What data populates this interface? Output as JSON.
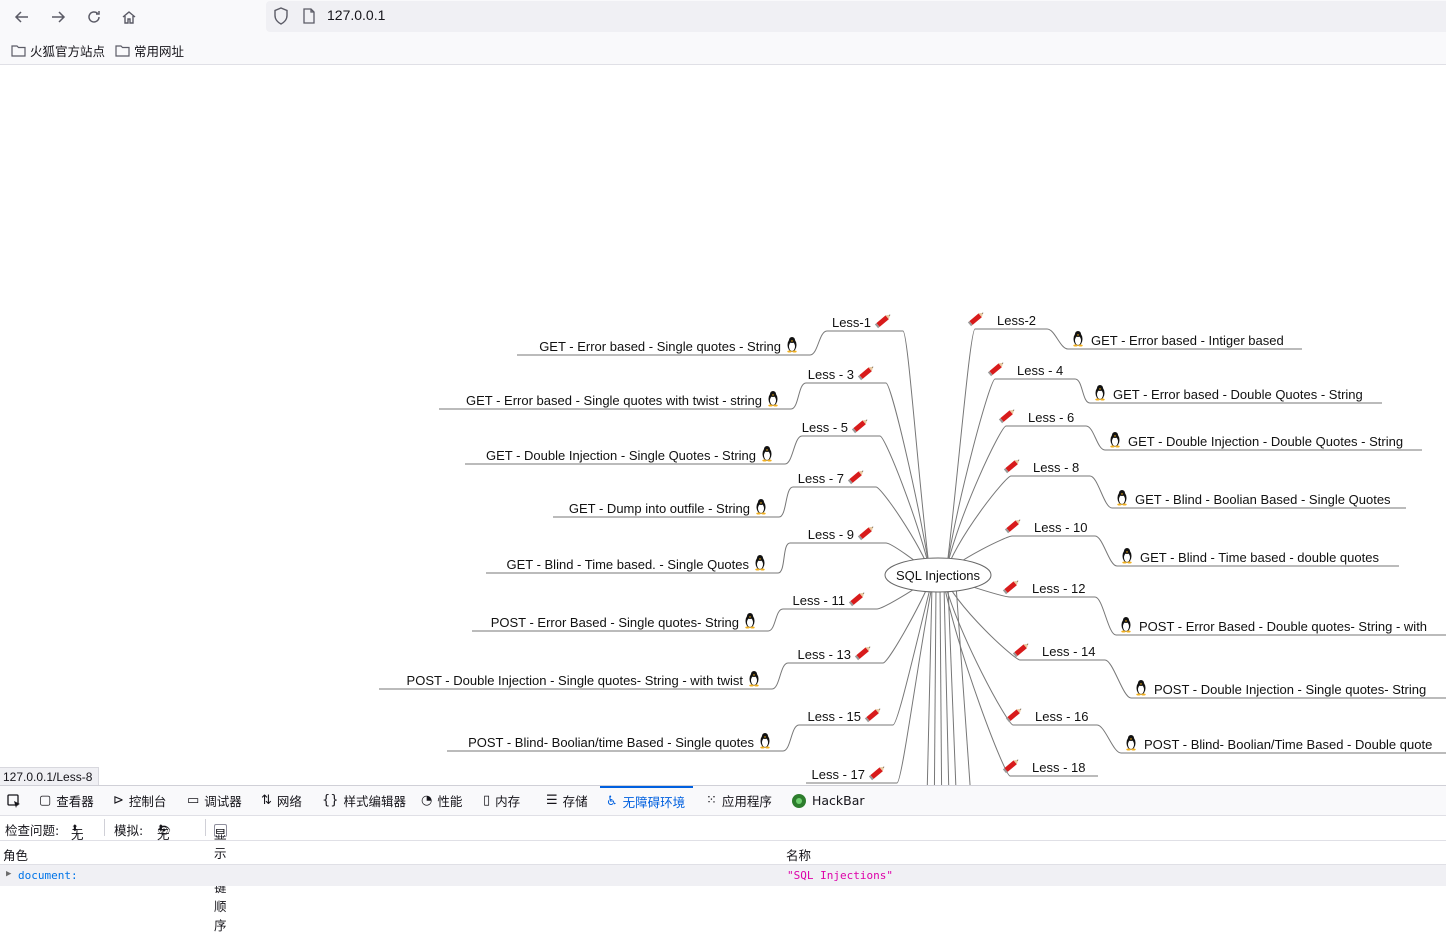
{
  "browser": {
    "url": "127.0.0.1",
    "bookmarks": [
      "火狐官方站点",
      "常用网址"
    ],
    "status_url": "127.0.0.1/Less-8"
  },
  "mindmap": {
    "center": "SQL Injections",
    "left": [
      {
        "less": "Less-1",
        "desc": "GET - Error based - Single quotes - String"
      },
      {
        "less": "Less - 3",
        "desc": "GET - Error based - Single quotes with twist - string"
      },
      {
        "less": "Less - 5",
        "desc": "GET - Double Injection - Single Quotes - String"
      },
      {
        "less": "Less - 7",
        "desc": "GET - Dump into outfile - String"
      },
      {
        "less": "Less - 9",
        "desc": "GET - Blind - Time based. -  Single Quotes"
      },
      {
        "less": "Less - 11",
        "desc": "POST - Error Based - Single quotes- String"
      },
      {
        "less": "Less - 13",
        "desc": "POST - Double Injection - Single quotes- String - with twist"
      },
      {
        "less": "Less - 15",
        "desc": "POST - Blind- Boolian/time Based - Single quotes"
      },
      {
        "less": "Less - 17",
        "desc": ""
      }
    ],
    "right": [
      {
        "less": "Less-2",
        "desc": "GET - Error based - Intiger based"
      },
      {
        "less": "Less - 4",
        "desc": "GET - Error based - Double Quotes - String"
      },
      {
        "less": "Less - 6",
        "desc": "GET - Double Injection - Double Quotes - String"
      },
      {
        "less": "Less - 8",
        "desc": "GET - Blind - Boolian Based - Single Quotes"
      },
      {
        "less": "Less - 10",
        "desc": "GET - Blind - Time based - double quotes"
      },
      {
        "less": "Less - 12",
        "desc": "POST - Error Based - Double quotes- String - with"
      },
      {
        "less": "Less - 14",
        "desc": "POST - Double Injection - Single quotes- String"
      },
      {
        "less": "Less - 16",
        "desc": "POST - Blind- Boolian/Time Based - Double quote"
      },
      {
        "less": "Less - 18",
        "desc": ""
      }
    ]
  },
  "devtools": {
    "tabs": [
      "查看器",
      "控制台",
      "调试器",
      "网络",
      "样式编辑器",
      "性能",
      "内存",
      "存储",
      "无障碍环境",
      "应用程序",
      "HackBar"
    ],
    "active_tab": "无障碍环境",
    "toolbar": {
      "check_label": "检查问题:",
      "check_value": "无",
      "simulate_label": "模拟:",
      "simulate_value": "无",
      "tab_order_label": "显示 Tab 键顺序"
    },
    "columns": {
      "role": "角色",
      "name": "名称"
    },
    "row": {
      "role": "document:",
      "name": "\"SQL Injections\""
    }
  },
  "colors": {
    "accent": "#0060df",
    "role_blue": "#0074e8",
    "name_pink": "#dd00a9"
  }
}
